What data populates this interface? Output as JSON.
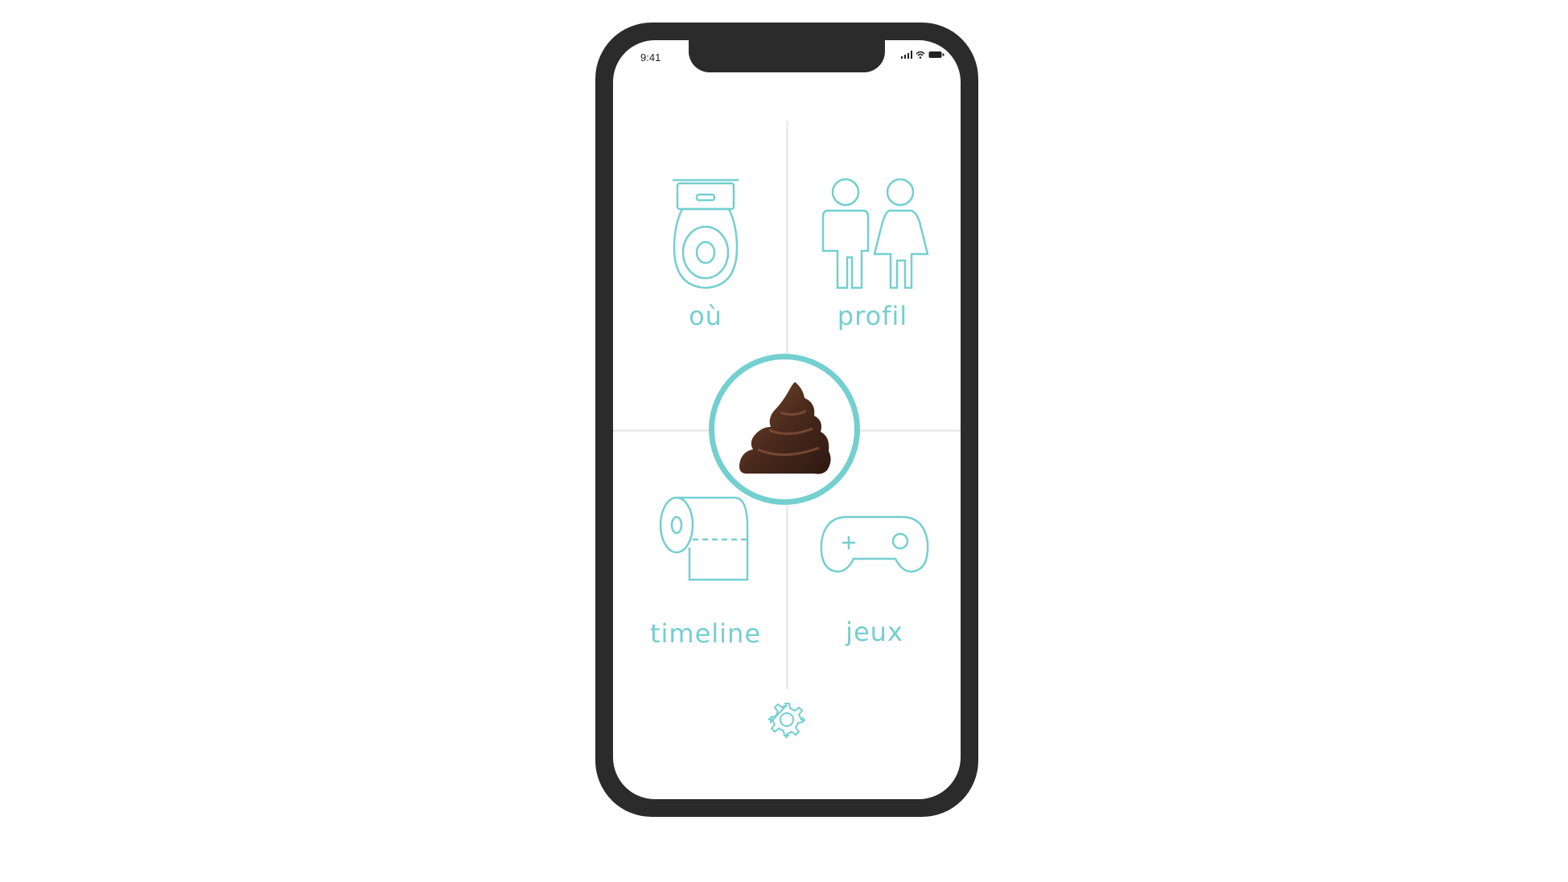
{
  "status_bar": {
    "time": "9:41",
    "icons": [
      "signal-icon",
      "wifi-icon",
      "battery-icon"
    ]
  },
  "menu": {
    "top_left": {
      "label": "où",
      "icon": "toilet-icon"
    },
    "top_right": {
      "label": "profil",
      "icon": "man-woman-icon"
    },
    "bottom_left": {
      "label": "timeline",
      "icon": "toilet-paper-icon"
    },
    "bottom_right": {
      "label": "jeux",
      "icon": "gamepad-icon"
    }
  },
  "center_button": {
    "icon": "poop-icon"
  },
  "settings": {
    "icon": "gear-icon"
  },
  "colors": {
    "accent": "#74cfd0",
    "frame": "#2b2b2b",
    "divider": "#ececec",
    "poop": "#4a2a1c"
  }
}
